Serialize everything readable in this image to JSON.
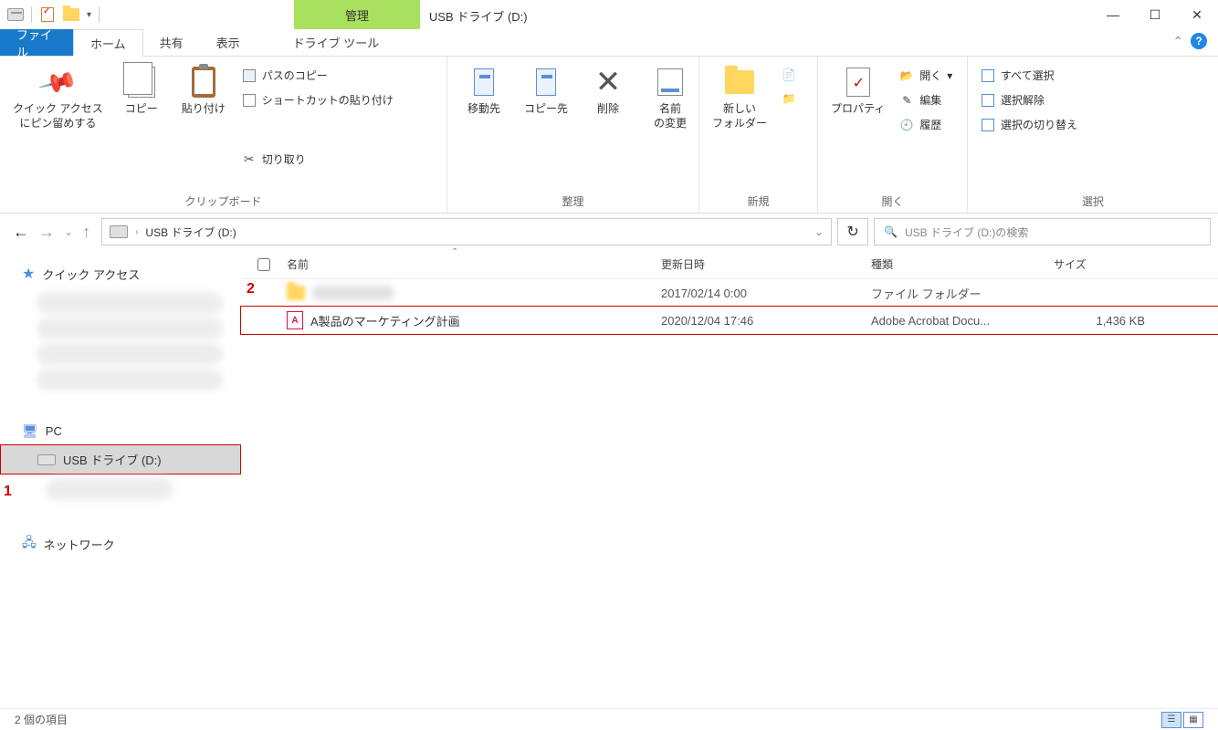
{
  "window": {
    "title": "USB ドライブ (D:)",
    "manage_tab": "管理"
  },
  "tabs": {
    "file": "ファイル",
    "home": "ホーム",
    "share": "共有",
    "view": "表示",
    "drive_tools": "ドライブ ツール"
  },
  "ribbon": {
    "clipboard": {
      "label": "クリップボード",
      "pin": "クイック アクセス\nにピン留めする",
      "copy": "コピー",
      "paste": "貼り付け",
      "copy_path": "パスのコピー",
      "paste_shortcut": "ショートカットの貼り付け",
      "cut": "切り取り"
    },
    "organize": {
      "label": "整理",
      "move_to": "移動先",
      "copy_to": "コピー先",
      "delete": "削除",
      "rename": "名前\nの変更"
    },
    "new": {
      "label": "新規",
      "new_folder": "新しい\nフォルダー"
    },
    "open": {
      "label": "開く",
      "properties": "プロパティ",
      "open": "開く",
      "edit": "編集",
      "history": "履歴"
    },
    "select": {
      "label": "選択",
      "select_all": "すべて選択",
      "deselect": "選択解除",
      "invert": "選択の切り替え"
    }
  },
  "addr": {
    "location": "USB ドライブ (D:)"
  },
  "search": {
    "placeholder": "USB ドライブ (D:)の検索"
  },
  "nav": {
    "quick_access": "クイック アクセス",
    "pc": "PC",
    "usb_drive": "USB ドライブ (D:)",
    "network": "ネットワーク"
  },
  "columns": {
    "name": "名前",
    "date": "更新日時",
    "type": "種類",
    "size": "サイズ"
  },
  "files": [
    {
      "name": "",
      "date": "2017/02/14 0:00",
      "type": "ファイル フォルダー",
      "size": "",
      "is_folder": true
    },
    {
      "name": "A製品のマーケティング計画",
      "date": "2020/12/04 17:46",
      "type": "Adobe Acrobat Docu...",
      "size": "1,436 KB",
      "is_folder": false
    }
  ],
  "status": {
    "count": "2 個の項目"
  },
  "annotations": {
    "one": "1",
    "two": "2"
  }
}
